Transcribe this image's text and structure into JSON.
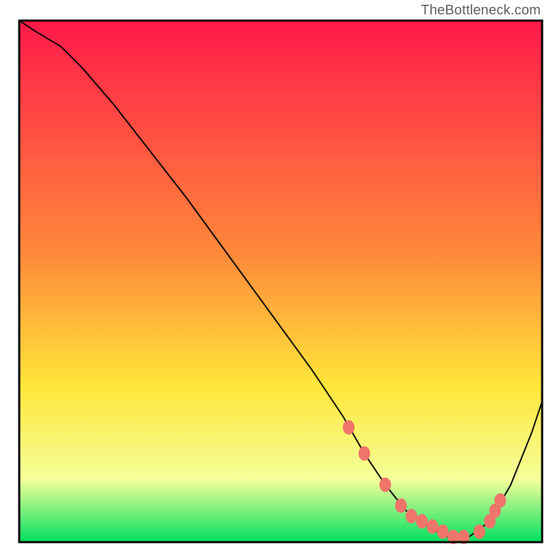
{
  "watermark": "TheBottleneck.com",
  "colors": {
    "curve": "#000000",
    "marker_fill": "#ef756b",
    "marker_stroke": "#ef756b",
    "border": "#000000",
    "grad_top": "#ff1a4a",
    "grad_mid_orange": "#ff8a3a",
    "grad_mid_yellow": "#ffe63a",
    "grad_light": "#f5ff9a",
    "grad_green": "#00e060"
  },
  "chart_data": {
    "type": "line",
    "title": "",
    "xlabel": "",
    "ylabel": "",
    "xlim": [
      0,
      100
    ],
    "ylim": [
      0,
      100
    ],
    "legend": false,
    "grid": false,
    "series": [
      {
        "name": "curve",
        "x": [
          0,
          3,
          8,
          12,
          18,
          25,
          32,
          40,
          48,
          56,
          62,
          66,
          70,
          74,
          78,
          82,
          86,
          90,
          94,
          98,
          100
        ],
        "y": [
          100,
          98,
          95,
          91,
          84,
          75,
          66,
          55,
          44,
          33,
          24,
          17,
          11,
          6,
          3,
          1,
          1,
          4,
          11,
          21,
          27
        ]
      }
    ],
    "markers": {
      "name": "dots",
      "x": [
        63,
        66,
        70,
        73,
        75,
        77,
        79,
        81,
        83,
        85,
        88,
        90,
        91,
        92
      ],
      "y": [
        22,
        17,
        11,
        7,
        5,
        4,
        3,
        2,
        1,
        1,
        2,
        4,
        6,
        8
      ]
    }
  }
}
